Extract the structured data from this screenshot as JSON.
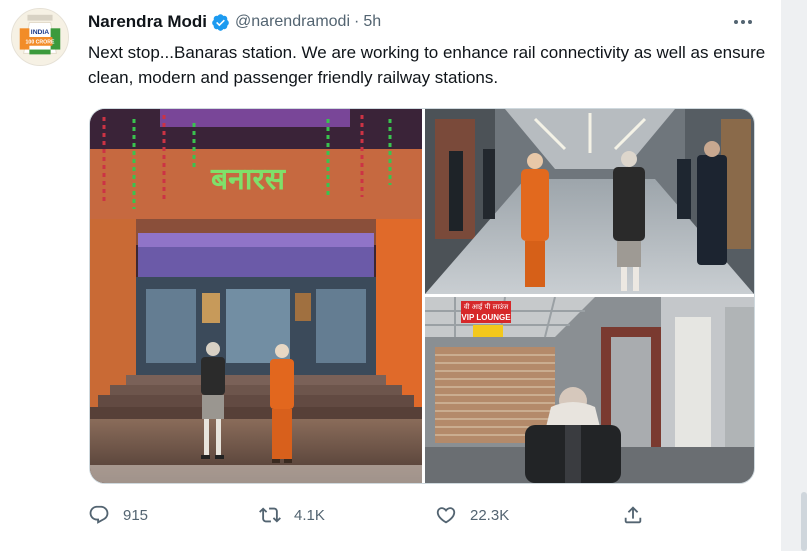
{
  "tweet": {
    "author_name": "Narendra Modi",
    "handle": "@narendramodi",
    "separator": "·",
    "timestamp": "5h",
    "text": "Next stop...Banaras station. We are working to enhance rail connectivity as well as ensure clean, modern and passenger friendly railway stations.",
    "avatar_badge_text": [
      "INDIA",
      "100 CRORE"
    ]
  },
  "media": {
    "photo1_sign": "बनारस",
    "photo3_sign_top": "वी आई पी लाउंज",
    "photo3_sign_main": "VIP LOUNGE"
  },
  "actions": {
    "replies": "915",
    "retweets": "4.1K",
    "likes": "22.3K"
  },
  "icons": {
    "verified": "verified-badge-icon",
    "more": "more-options-icon",
    "reply": "reply-icon",
    "retweet": "retweet-icon",
    "like": "like-icon",
    "share": "share-icon"
  },
  "colors": {
    "verified": "#1d9bf0",
    "text_primary": "#0f1419",
    "text_secondary": "#536471",
    "border": "#cfd9de"
  }
}
